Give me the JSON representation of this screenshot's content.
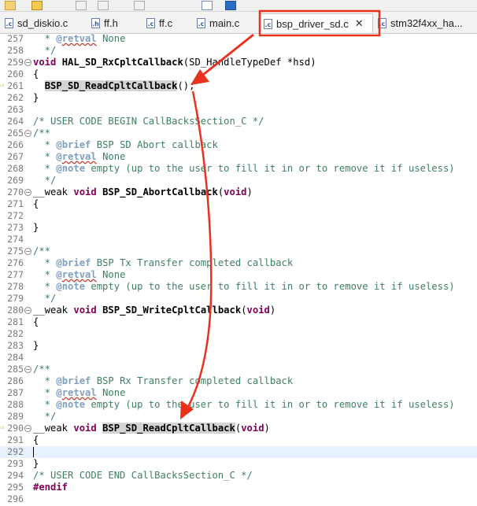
{
  "tabs": [
    {
      "label": "sd_diskio.c",
      "icon": "c-file-icon",
      "glyph": ".c",
      "active": false
    },
    {
      "label": "ff.h",
      "icon": "h-file-icon",
      "glyph": ".h",
      "active": false
    },
    {
      "label": "ff.c",
      "icon": "c-file-icon",
      "glyph": ".c",
      "active": false
    },
    {
      "label": "main.c",
      "icon": "c-file-icon",
      "glyph": ".c",
      "active": false
    },
    {
      "label": "bsp_driver_sd.c",
      "icon": "c-file-icon",
      "glyph": ".c",
      "active": true,
      "close": "✕"
    },
    {
      "label": "stm32f4xx_ha...",
      "icon": "c-file-icon",
      "glyph": ".c",
      "active": false
    }
  ],
  "lines": [
    {
      "n": "257",
      "t": "  * @retval None"
    },
    {
      "n": "258",
      "t": "  */"
    },
    {
      "n": "259",
      "t": "void HAL_SD_RxCpltCallback(SD_HandleTypeDef *hsd)"
    },
    {
      "n": "260",
      "t": "{"
    },
    {
      "n": "261",
      "t": "  BSP_SD_ReadCpltCallback();"
    },
    {
      "n": "262",
      "t": "}"
    },
    {
      "n": "263",
      "t": ""
    },
    {
      "n": "264",
      "t": "/* USER CODE BEGIN CallBacksSection_C */"
    },
    {
      "n": "265",
      "t": "/**"
    },
    {
      "n": "266",
      "t": "  * @brief BSP SD Abort callback"
    },
    {
      "n": "267",
      "t": "  * @retval None"
    },
    {
      "n": "268",
      "t": "  * @note empty (up to the user to fill it in or to remove it if useless)"
    },
    {
      "n": "269",
      "t": "  */"
    },
    {
      "n": "270",
      "t": "__weak void BSP_SD_AbortCallback(void)"
    },
    {
      "n": "271",
      "t": "{"
    },
    {
      "n": "272",
      "t": ""
    },
    {
      "n": "273",
      "t": "}"
    },
    {
      "n": "274",
      "t": ""
    },
    {
      "n": "275",
      "t": "/**"
    },
    {
      "n": "276",
      "t": "  * @brief BSP Tx Transfer completed callback"
    },
    {
      "n": "277",
      "t": "  * @retval None"
    },
    {
      "n": "278",
      "t": "  * @note empty (up to the user to fill it in or to remove it if useless)"
    },
    {
      "n": "279",
      "t": "  */"
    },
    {
      "n": "280",
      "t": "__weak void BSP_SD_WriteCpltCallback(void)"
    },
    {
      "n": "281",
      "t": "{"
    },
    {
      "n": "282",
      "t": ""
    },
    {
      "n": "283",
      "t": "}"
    },
    {
      "n": "284",
      "t": ""
    },
    {
      "n": "285",
      "t": "/**"
    },
    {
      "n": "286",
      "t": "  * @brief BSP Rx Transfer completed callback"
    },
    {
      "n": "287",
      "t": "  * @retval None"
    },
    {
      "n": "288",
      "t": "  * @note empty (up to the user to fill it in or to remove it if useless)"
    },
    {
      "n": "289",
      "t": "  */"
    },
    {
      "n": "290",
      "t": "__weak void BSP_SD_ReadCpltCallback(void)"
    },
    {
      "n": "291",
      "t": "{"
    },
    {
      "n": "292",
      "t": ""
    },
    {
      "n": "293",
      "t": "}"
    },
    {
      "n": "294",
      "t": "/* USER CODE END CallBacksSection_C */"
    },
    {
      "n": "295",
      "t": "#endif"
    },
    {
      "n": "296",
      "t": ""
    }
  ],
  "colors": {
    "annotation": "#e8321e",
    "comment": "#3f7f5f",
    "keyword": "#7f0055",
    "current_line": "#e8f2fe"
  }
}
